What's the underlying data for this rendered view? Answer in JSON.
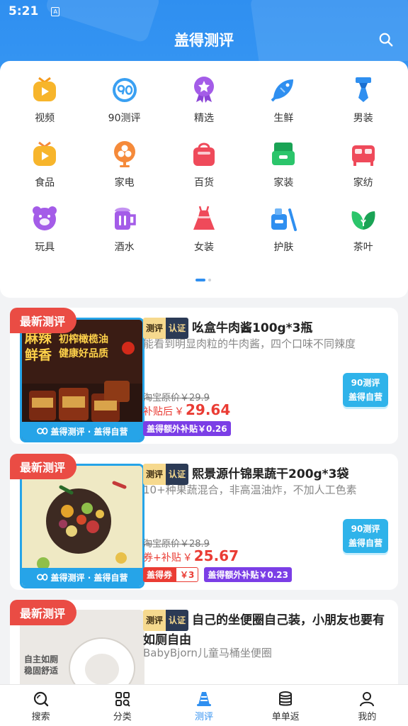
{
  "status": {
    "time": "5:21",
    "notif_glyph": "A"
  },
  "header": {
    "title": "盖得测评"
  },
  "categories": [
    {
      "label": "视频",
      "icon": "video-icon",
      "color": "#f7b52b"
    },
    {
      "label": "90测评",
      "icon": "90-review-icon",
      "color": "#3aa0f2"
    },
    {
      "label": "精选",
      "icon": "medal-icon",
      "color": "#a45ce8"
    },
    {
      "label": "生鲜",
      "icon": "fish-icon",
      "color": "#2f8ff0"
    },
    {
      "label": "男装",
      "icon": "tie-icon",
      "color": "#2f8ff0"
    },
    {
      "label": "食品",
      "icon": "food-icon",
      "color": "#f7b52b"
    },
    {
      "label": "家电",
      "icon": "fan-icon",
      "color": "#f58a3a"
    },
    {
      "label": "百货",
      "icon": "bag-icon",
      "color": "#ef4a5a"
    },
    {
      "label": "家装",
      "icon": "house-icon",
      "color": "#2bc56b"
    },
    {
      "label": "家纺",
      "icon": "bed-icon",
      "color": "#ef4a5a"
    },
    {
      "label": "玩具",
      "icon": "bear-icon",
      "color": "#a45ce8"
    },
    {
      "label": "酒水",
      "icon": "beer-icon",
      "color": "#a45ce8"
    },
    {
      "label": "女装",
      "icon": "dress-icon",
      "color": "#ef4a5a"
    },
    {
      "label": "护肤",
      "icon": "cosmetics-icon",
      "color": "#2f8ff0"
    },
    {
      "label": "茶叶",
      "icon": "tea-leaf-icon",
      "color": "#2bc56b"
    }
  ],
  "cards": [
    {
      "tag": "最新测评",
      "badge_a": "测评",
      "badge_b": "认证",
      "title": "吆盒牛肉酱100g*3瓶",
      "subtitle": "能看到明显肉粒的牛肉酱，四个口味不同辣度",
      "orig_price": "淘宝原价￥29.9",
      "sale_label": "补贴后",
      "sale_yen": "￥",
      "sale_value": "29.64",
      "extra_subsidy": "盖得额外补贴￥0.26",
      "self_badge_top": "90测评",
      "self_badge_bottom": "盖得自营",
      "img_text_1": "麻辣",
      "img_text_2": "鲜香",
      "img_text_3": "初榨橄榄油",
      "img_text_4": "健康好品质",
      "img_footer": "盖得测评 · 盖得自营"
    },
    {
      "tag": "最新测评",
      "badge_a": "测评",
      "badge_b": "认证",
      "title": "熙景源什锦果蔬干200g*3袋",
      "subtitle": "10+种果蔬混合，非高温油炸，不加人工色素",
      "orig_price": "淘宝原价￥28.9",
      "sale_label": "券+补贴",
      "sale_yen": "￥",
      "sale_value": "25.67",
      "coupon_label": "盖得券",
      "coupon_value": "￥3",
      "extra_subsidy": "盖得额外补贴￥0.23",
      "self_badge_top": "90测评",
      "self_badge_bottom": "盖得自营",
      "img_footer": "盖得测评 · 盖得自营"
    },
    {
      "tag": "最新测评",
      "badge_a": "测评",
      "badge_b": "认证",
      "title": "自己的坐便圈自己装，小朋友也要有如厕自由",
      "subtitle": "BabyBjorn儿童马桶坐便圈",
      "img_text_1": "自主如厕",
      "img_text_2": "稳固舒适"
    }
  ],
  "nav": [
    {
      "label": "搜索",
      "icon": "search-icon"
    },
    {
      "label": "分类",
      "icon": "category-grid-icon"
    },
    {
      "label": "测评",
      "icon": "review-cone-icon",
      "active": true
    },
    {
      "label": "单单返",
      "icon": "coins-icon"
    },
    {
      "label": "我的",
      "icon": "profile-icon"
    }
  ],
  "colors": {
    "brand": "#2f8ff0",
    "price_red": "#ea3c34",
    "purple": "#7b3ee6"
  }
}
